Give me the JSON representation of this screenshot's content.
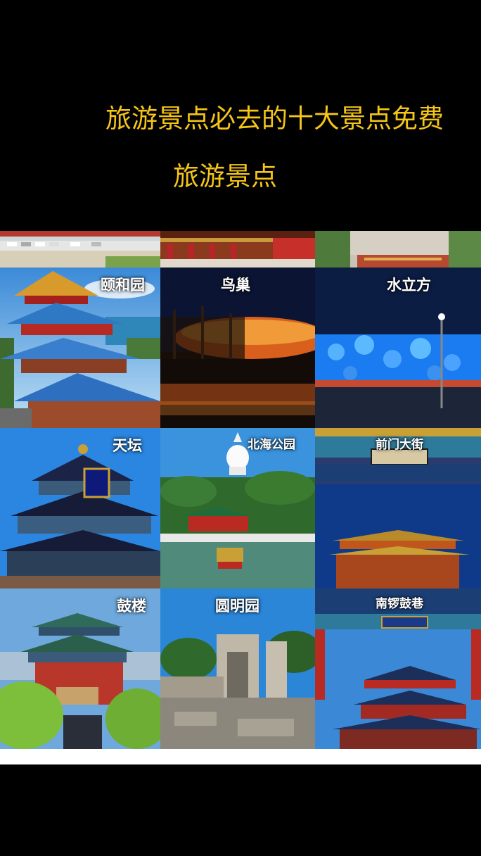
{
  "caption": {
    "line1": "旅游景点必去的十大景点免费",
    "line2": "旅游景点"
  },
  "tiles": [
    {
      "label": "颐和园"
    },
    {
      "label": "鸟巢"
    },
    {
      "label": "水立方"
    },
    {
      "label": "天坛"
    },
    {
      "label": "北海公园"
    },
    {
      "label": "前门大街"
    },
    {
      "label": "鼓楼"
    },
    {
      "label": "圆明园"
    },
    {
      "label": "南锣鼓巷"
    }
  ]
}
